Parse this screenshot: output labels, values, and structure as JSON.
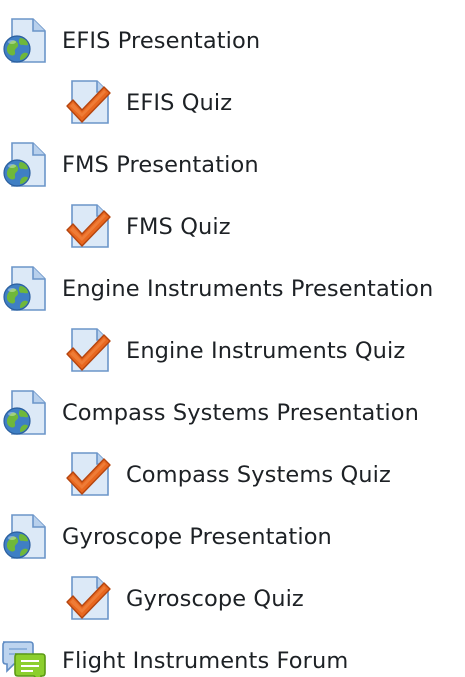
{
  "activities": [
    {
      "type": "resource",
      "icon": "web-page-globe-icon",
      "label": "EFIS Presentation"
    },
    {
      "type": "quiz",
      "icon": "quiz-checkmark-icon",
      "label": "EFIS Quiz"
    },
    {
      "type": "resource",
      "icon": "web-page-globe-icon",
      "label": "FMS Presentation"
    },
    {
      "type": "quiz",
      "icon": "quiz-checkmark-icon",
      "label": "FMS Quiz"
    },
    {
      "type": "resource",
      "icon": "web-page-globe-icon",
      "label": "Engine Instruments Presentation"
    },
    {
      "type": "quiz",
      "icon": "quiz-checkmark-icon",
      "label": "Engine Instruments Quiz"
    },
    {
      "type": "resource",
      "icon": "web-page-globe-icon",
      "label": "Compass Systems Presentation"
    },
    {
      "type": "quiz",
      "icon": "quiz-checkmark-icon",
      "label": "Compass Systems Quiz"
    },
    {
      "type": "resource",
      "icon": "web-page-globe-icon",
      "label": "Gyroscope Presentation"
    },
    {
      "type": "quiz",
      "icon": "quiz-checkmark-icon",
      "label": "Gyroscope Quiz"
    },
    {
      "type": "forum",
      "icon": "forum-speech-bubbles-icon",
      "label": "Flight Instruments Forum"
    }
  ],
  "colors": {
    "text": "#1d2125",
    "page_blue": "#c9dcf1",
    "globe_blue": "#4c86c8",
    "globe_green": "#7bbf3a",
    "check_orange": "#e2611b",
    "forum_green": "#8ccf2e"
  }
}
